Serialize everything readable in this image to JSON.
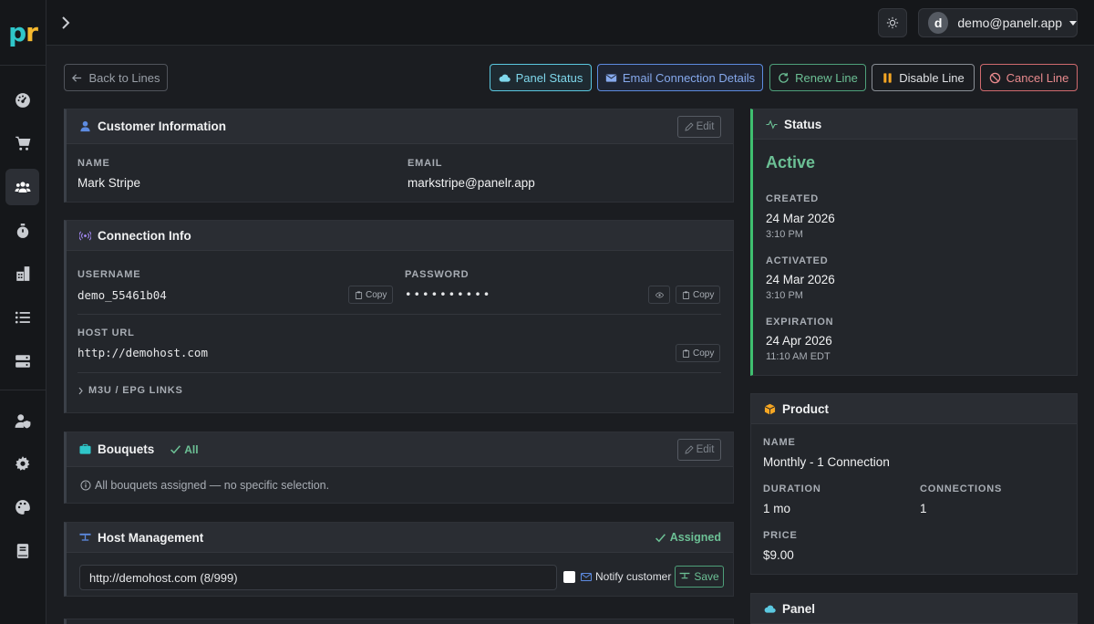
{
  "brand": {
    "logo_p": "p",
    "logo_r": "r"
  },
  "sidebar": {
    "items": [
      {
        "icon": "gauge-icon"
      },
      {
        "icon": "cart-icon"
      },
      {
        "icon": "users-icon",
        "active": true
      },
      {
        "icon": "stopwatch-icon"
      },
      {
        "icon": "building-icon"
      },
      {
        "icon": "list-icon"
      },
      {
        "icon": "server-icon"
      },
      {
        "icon": "user-shield-icon"
      },
      {
        "icon": "gear-icon"
      },
      {
        "icon": "palette-icon"
      },
      {
        "icon": "book-icon"
      }
    ]
  },
  "topbar": {
    "avatar_letter": "d",
    "user_email": "demo@panelr.app"
  },
  "actions": {
    "back": "Back to Lines",
    "panel_status": "Panel Status",
    "email_details": "Email Connection Details",
    "renew": "Renew Line",
    "disable": "Disable Line",
    "cancel": "Cancel Line"
  },
  "customer": {
    "title": "Customer Information",
    "edit": "Edit",
    "name_label": "NAME",
    "name": "Mark Stripe",
    "email_label": "EMAIL",
    "email": "markstripe@panelr.app"
  },
  "connection": {
    "title": "Connection Info",
    "username_label": "USERNAME",
    "username": "demo_55461b04",
    "password_label": "PASSWORD",
    "password": "••••••••••",
    "copy": "Copy",
    "host_label": "HOST URL",
    "host_url": "http://demohost.com",
    "links_label": "M3U / EPG LINKS"
  },
  "bouquets": {
    "title": "Bouquets",
    "badge": "All",
    "edit": "Edit",
    "note": "All bouquets assigned — no specific selection."
  },
  "host_mgmt": {
    "title": "Host Management",
    "status": "Assigned",
    "host_value": "http://demohost.com (8/999)",
    "notify_label": "Notify customer",
    "save": "Save"
  },
  "status": {
    "title": "Status",
    "state": "Active",
    "created_label": "CREATED",
    "created_date": "24 Mar 2026",
    "created_time": "3:10 PM",
    "activated_label": "ACTIVATED",
    "activated_date": "24 Mar 2026",
    "activated_time": "3:10 PM",
    "expiration_label": "EXPIRATION",
    "expiration_date": "24 Apr 2026",
    "expiration_time": "11:10 AM EDT"
  },
  "product": {
    "title": "Product",
    "name_label": "NAME",
    "name": "Monthly - 1 Connection",
    "duration_label": "DURATION",
    "duration": "1 mo",
    "connections_label": "CONNECTIONS",
    "connections": "1",
    "price_label": "PRICE",
    "price": "$9.00"
  },
  "panel": {
    "title": "Panel"
  },
  "colors": {
    "accent_green": "#3fbf6f",
    "accent_cyan": "#5bc8e0",
    "accent_blue": "#5d8be0",
    "danger": "#d06a6e"
  }
}
